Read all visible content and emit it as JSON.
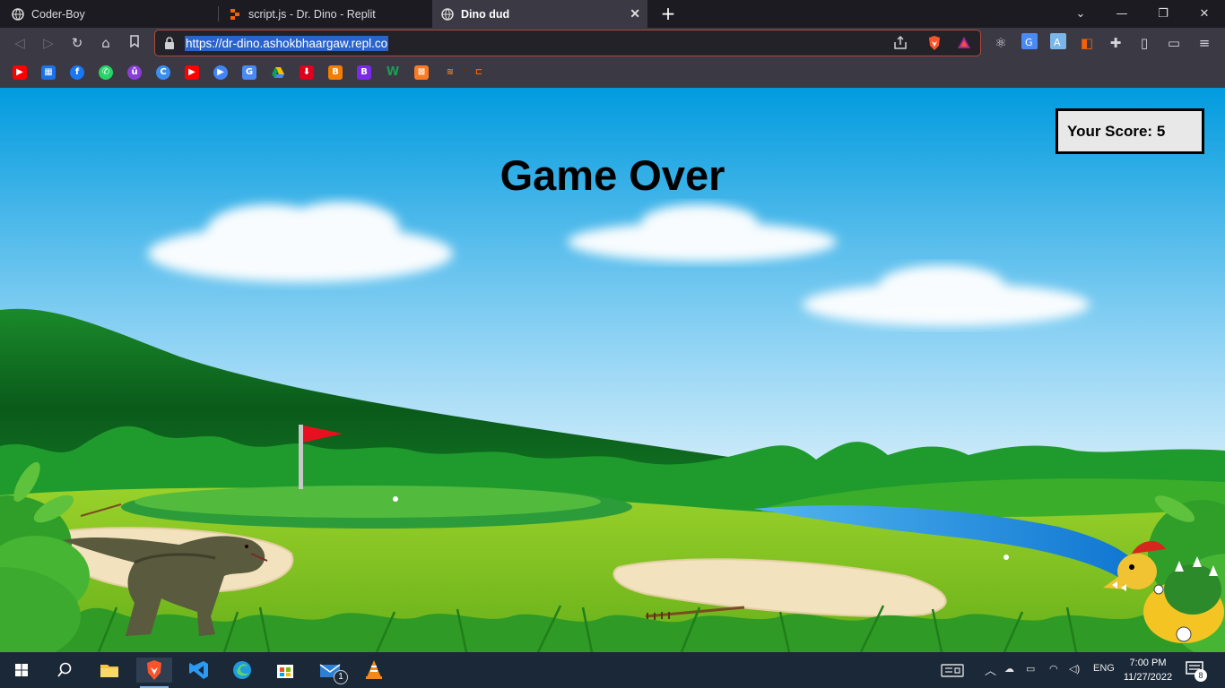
{
  "browser": {
    "tabs": [
      {
        "title": "Coder-Boy",
        "icon": "globe-icon",
        "active": false
      },
      {
        "title": "script.js - Dr. Dino - Replit",
        "icon": "replit-icon",
        "active": false
      },
      {
        "title": "Dino dud",
        "icon": "globe-icon",
        "active": true
      }
    ],
    "new_tab_label": "+",
    "url": "https://dr-dino.ashokbhaargaw.repl.co",
    "bookmarks": [
      "youtube",
      "calendar",
      "facebook",
      "whatsapp",
      "u",
      "c",
      "youtube",
      "play",
      "translate",
      "drive",
      "download",
      "blogger",
      "b",
      "w",
      "xampp",
      "stackoverflow",
      "replit"
    ]
  },
  "game": {
    "title": "Game Over",
    "score_label": "Your Score:",
    "score_value": "5"
  },
  "taskbar": {
    "apps": [
      "windows-start",
      "search",
      "file-explorer",
      "brave",
      "vscode",
      "edge",
      "ms-store",
      "mail",
      "vlc"
    ],
    "mail_badge": "1",
    "language": "ENG",
    "time": "7:00 PM",
    "date": "11/27/2022",
    "notification_count": "8"
  },
  "colors": {
    "sky_top": "#019bdf",
    "grass": "#7fc21f",
    "hill_dark": "#0c6a1e",
    "flag": "#e8101f",
    "sand": "#f2e2bd",
    "water": "#1a8ee0"
  }
}
